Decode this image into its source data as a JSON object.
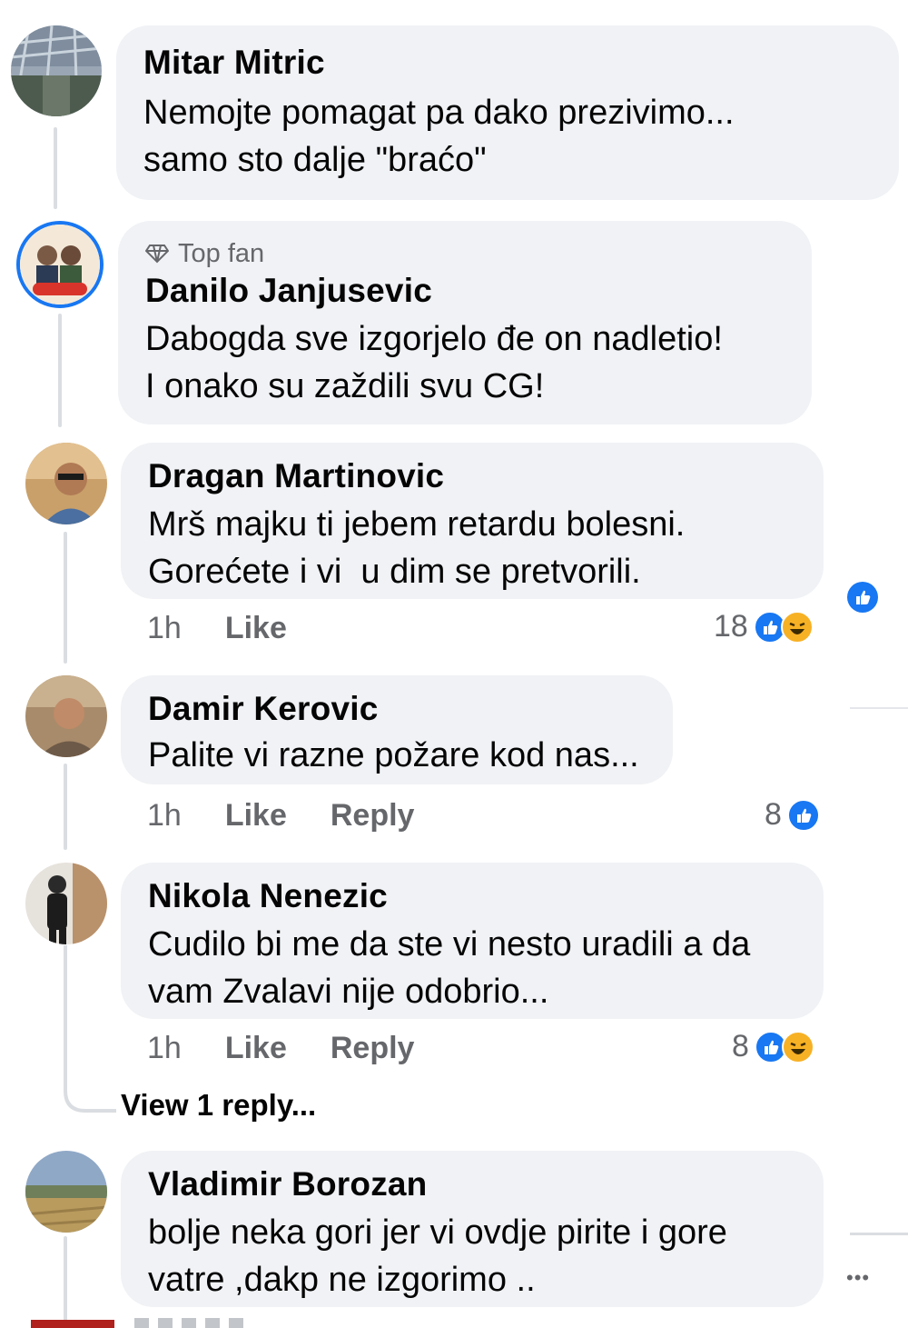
{
  "comments": [
    {
      "name": "Mitar Mitric",
      "lines": [
        "Nemojte pomagat pa dako prezivimo...",
        "samo sto dalje \"braćo\""
      ]
    },
    {
      "badge": "Top fan",
      "name": "Danilo Janjusevic",
      "lines": [
        "Dabogda sve izgorjelo đe on nadletio!",
        "I onako su zaždili svu CG!"
      ]
    },
    {
      "name": "Dragan Martinovic",
      "lines": [
        "Mrš majku ti jebem retardu bolesni.",
        "Gorećete i vi  u dim se pretvorili."
      ],
      "time": "1h",
      "like": "Like",
      "reaction_count": "18"
    },
    {
      "name": "Damir Kerovic",
      "lines": [
        "Palite vi razne požare kod nas..."
      ],
      "time": "1h",
      "like": "Like",
      "reply": "Reply",
      "reaction_count": "8"
    },
    {
      "name": "Nikola Nenezic",
      "lines": [
        "Cudilo bi me da ste vi nesto uradili a da",
        "vam Zvalavi nije odobrio..."
      ],
      "time": "1h",
      "like": "Like",
      "reply": "Reply",
      "reaction_count": "8"
    },
    {
      "name": "Vladimir Borozan",
      "lines": [
        "bolje neka gori jer vi ovdje pirite i gore",
        "vatre ,dakp ne izgorimo .."
      ]
    }
  ],
  "view_replies": "View 1 reply...",
  "more_glyph": "•••",
  "colors": {
    "bubble": "#f0f2f5",
    "like": "#1877f2",
    "haha": "#f7b125",
    "meta": "#65676b"
  }
}
